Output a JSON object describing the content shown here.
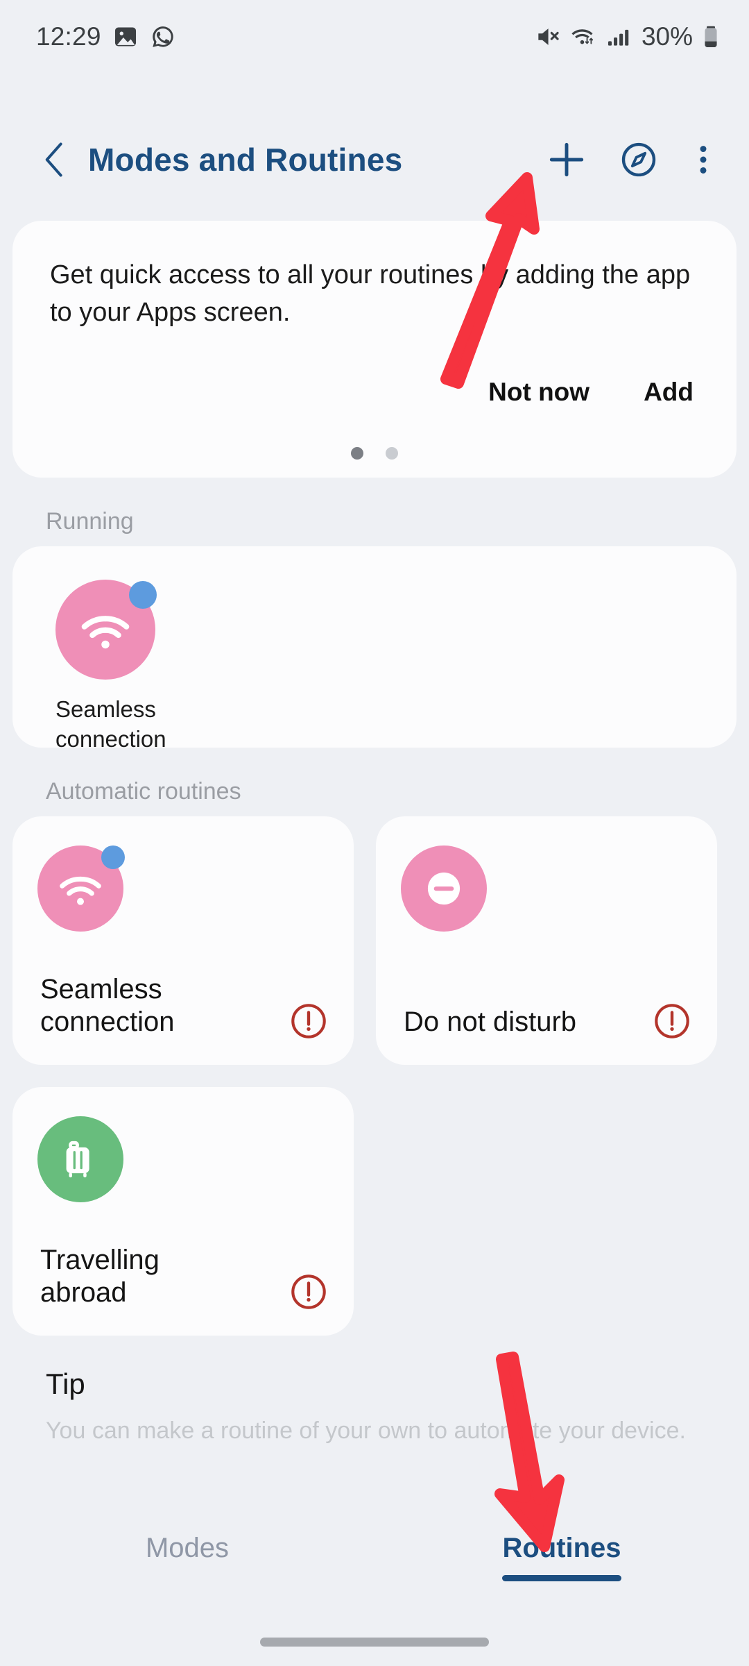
{
  "status_bar": {
    "time": "12:29",
    "left_icons": [
      "gallery-icon",
      "whatsapp-icon"
    ],
    "battery_percent": "30%",
    "right_icons": [
      "mute-icon",
      "wifi-icon",
      "signal-icon",
      "battery-icon"
    ]
  },
  "header": {
    "title": "Modes and Routines",
    "back_icon": "back-chevron-icon",
    "add_icon": "plus-icon",
    "discover_icon": "compass-icon",
    "menu_icon": "more-options-icon",
    "accent_color": "#1C4E80"
  },
  "banner": {
    "text": "Get quick access to all your routines by adding the app to your Apps screen.",
    "not_now_label": "Not now",
    "add_label": "Add",
    "page_dots": 2,
    "active_dot": 1
  },
  "sections": {
    "running_label": "Running",
    "automatic_label": "Automatic routines",
    "tip_label": "Tip",
    "tip_body": "You can make a routine of your own to automate your device."
  },
  "running": [
    {
      "name_line1": "Seamless",
      "name_line2": "connection",
      "icon": "wifi-icon",
      "icon_color": "#EF8FB7",
      "badge": true,
      "badge_color": "#5D9BDE"
    }
  ],
  "automatic_routines": [
    {
      "name_line1": "Seamless",
      "name_line2": "connection",
      "icon": "wifi-icon",
      "icon_color": "#EF8FB7",
      "badge": true,
      "badge_color": "#5D9BDE",
      "warning": true
    },
    {
      "name_line1": "Do not disturb",
      "name_line2": "",
      "icon": "do-not-disturb-icon",
      "icon_color": "#EF8FB7",
      "badge": false,
      "warning": true
    },
    {
      "name_line1": "Travelling",
      "name_line2": "abroad",
      "icon": "suitcase-icon",
      "icon_color": "#68BD7D",
      "badge": false,
      "warning": true
    }
  ],
  "warning_color": "#B3342B",
  "tabs": [
    {
      "label": "Modes",
      "active": false
    },
    {
      "label": "Routines",
      "active": true
    }
  ],
  "annotations": [
    {
      "name": "arrow-to-add-button",
      "color": "#F5333F",
      "direction": "up-right"
    },
    {
      "name": "arrow-to-routines-tab",
      "color": "#F5333F",
      "direction": "down"
    }
  ]
}
